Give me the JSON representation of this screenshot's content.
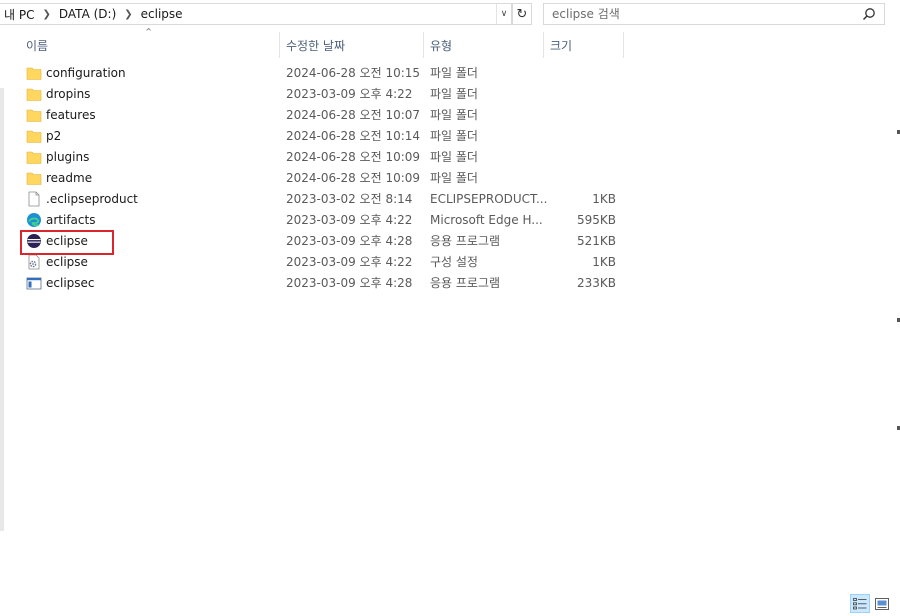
{
  "address": {
    "crumbs": [
      "내 PC",
      "DATA (D:)",
      "eclipse"
    ],
    "dropdown_glyph": "∨",
    "refresh_glyph": "↻"
  },
  "search": {
    "placeholder": "eclipse 검색"
  },
  "columns": {
    "name": "이름",
    "date": "수정한 날짜",
    "type": "유형",
    "size": "크기",
    "sort_glyph": "⌃"
  },
  "files": [
    {
      "name": "configuration",
      "date": "2024-06-28 오전 10:15",
      "type": "파일 폴더",
      "size": "",
      "icon": "folder-icon"
    },
    {
      "name": "dropins",
      "date": "2023-03-09 오후 4:22",
      "type": "파일 폴더",
      "size": "",
      "icon": "folder-icon"
    },
    {
      "name": "features",
      "date": "2024-06-28 오전 10:07",
      "type": "파일 폴더",
      "size": "",
      "icon": "folder-icon"
    },
    {
      "name": "p2",
      "date": "2024-06-28 오전 10:14",
      "type": "파일 폴더",
      "size": "",
      "icon": "folder-icon"
    },
    {
      "name": "plugins",
      "date": "2024-06-28 오전 10:09",
      "type": "파일 폴더",
      "size": "",
      "icon": "folder-icon"
    },
    {
      "name": "readme",
      "date": "2024-06-28 오전 10:09",
      "type": "파일 폴더",
      "size": "",
      "icon": "folder-icon"
    },
    {
      "name": ".eclipseproduct",
      "date": "2023-03-02 오전 8:14",
      "type": "ECLIPSEPRODUCT...",
      "size": "1KB",
      "icon": "file-icon"
    },
    {
      "name": "artifacts",
      "date": "2023-03-09 오후 4:22",
      "type": "Microsoft Edge H...",
      "size": "595KB",
      "icon": "edge-icon"
    },
    {
      "name": "eclipse",
      "date": "2023-03-09 오후 4:28",
      "type": "응용 프로그램",
      "size": "521KB",
      "icon": "eclipse-icon"
    },
    {
      "name": "eclipse",
      "date": "2023-03-09 오후 4:22",
      "type": "구성 설정",
      "size": "1KB",
      "icon": "config-file-icon"
    },
    {
      "name": "eclipsec",
      "date": "2023-03-09 오후 4:28",
      "type": "응용 프로그램",
      "size": "233KB",
      "icon": "console-app-icon"
    }
  ],
  "colors": {
    "highlight": "#d9262c",
    "folder": "#ffd75e",
    "selected_view": "#cce8ff"
  }
}
